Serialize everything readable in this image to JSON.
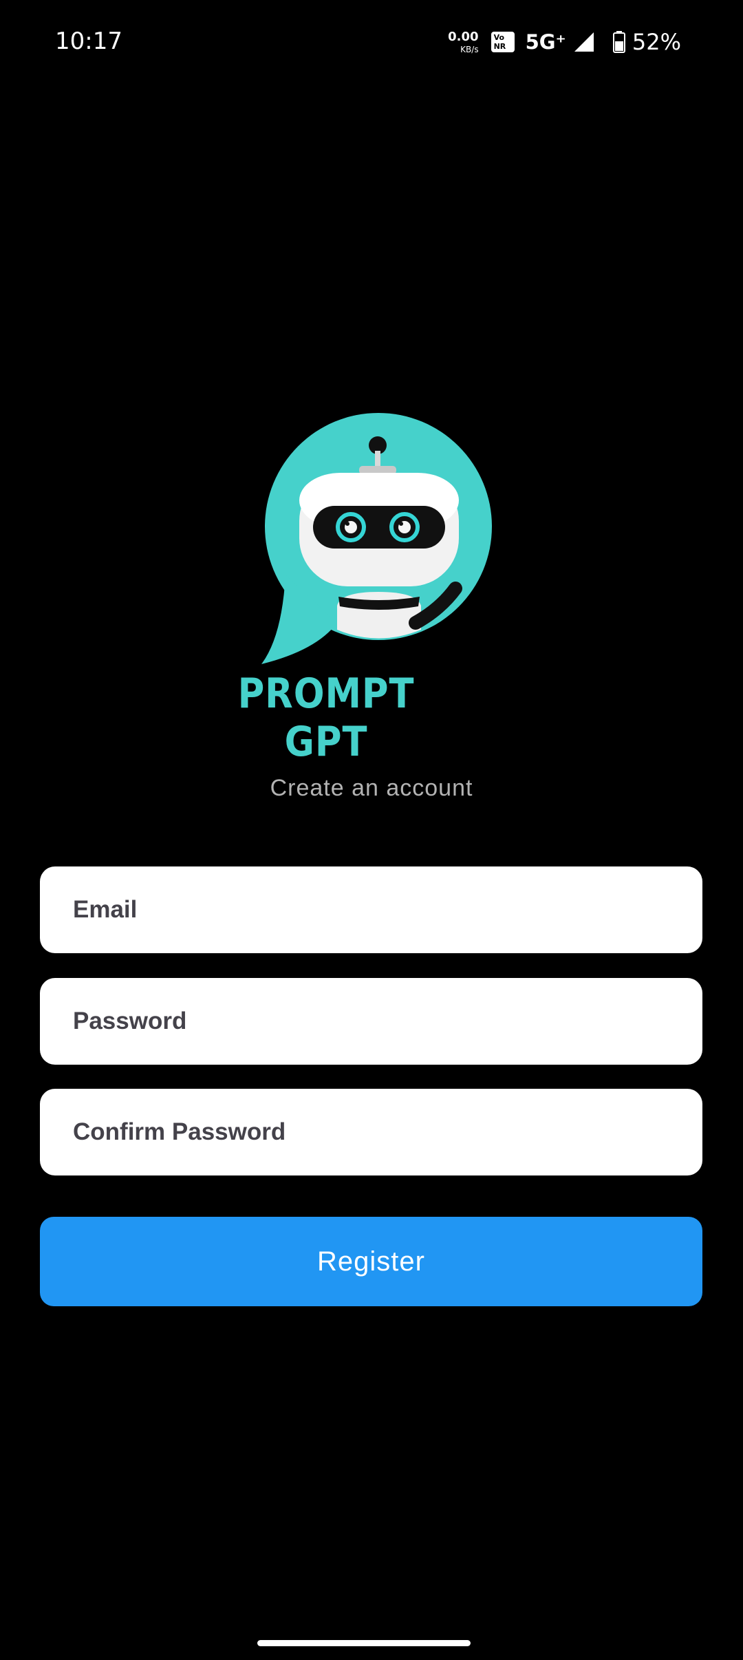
{
  "status_bar": {
    "time": "10:17",
    "net_speed_value": "0.00",
    "net_speed_unit": "KB/s",
    "vonr_top": "Vo",
    "vonr_bottom": "NR",
    "network_type": "5G⁺",
    "battery_percent": "52%"
  },
  "logo": {
    "text": "PROMPT GPT",
    "accent_color": "#46d1cb"
  },
  "subtitle": "Create an account",
  "form": {
    "email_placeholder": "Email",
    "password_placeholder": "Password",
    "confirm_placeholder": "Confirm Password",
    "register_label": "Register",
    "button_color": "#2196f3"
  },
  "icons": [
    "signal-icon",
    "battery-icon",
    "robot-logo-icon"
  ]
}
